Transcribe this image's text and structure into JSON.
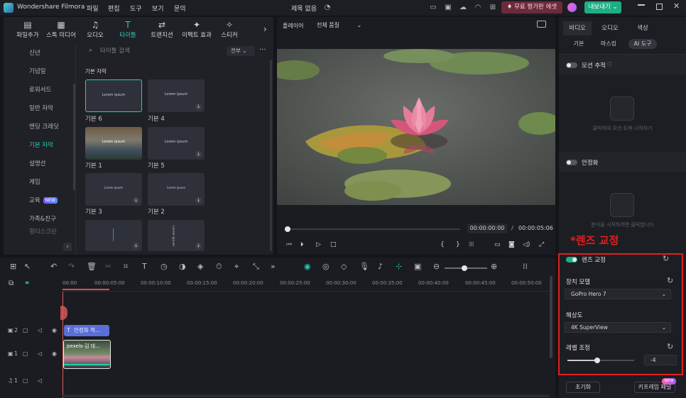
{
  "titlebar": {
    "app_name": "Wondershare Filmora",
    "menu": [
      "파일",
      "편집",
      "도구",
      "보기",
      "문의"
    ],
    "project_title": "제목 없음",
    "trial_button": "무료 평가판 에셋",
    "export_button": "내보내기"
  },
  "media_tabs": [
    {
      "label": "파일추가",
      "icon": "file-import-icon"
    },
    {
      "label": "스톡 미디어",
      "icon": "stock-media-icon"
    },
    {
      "label": "오디오",
      "icon": "music-icon"
    },
    {
      "label": "타이틀",
      "icon": "title-t-icon"
    },
    {
      "label": "트랜지션",
      "icon": "transition-icon"
    },
    {
      "label": "이펙트 효과",
      "icon": "effects-icon"
    },
    {
      "label": "스티커",
      "icon": "sticker-icon"
    }
  ],
  "categories": [
    "신년",
    "기념일",
    "로워서드",
    "일반 자막",
    "엔딩 크레딧",
    "기본 자막",
    "설명선",
    "게임",
    "교육",
    "가족&친구",
    "멀티스크린"
  ],
  "category_active": "기본 자막",
  "category_new_badge": "NEW",
  "search": {
    "placeholder": "타이틀 검색",
    "filter": "전부"
  },
  "section_title": "기본 자막",
  "tiles": [
    {
      "label": "기본 6",
      "preview": "Lorem ipsum"
    },
    {
      "label": "기본 4",
      "preview": "Lorem ipsum"
    },
    {
      "label": "기본 1",
      "preview": "Lorem ipsum"
    },
    {
      "label": "기본 5",
      "preview": "Lorem ipsum"
    },
    {
      "label": "기본 3",
      "preview": "Lorem ipsum"
    },
    {
      "label": "기본 2",
      "preview": "Lorem ipsum"
    },
    {
      "label": "",
      "preview": ""
    },
    {
      "label": "",
      "preview": "Lorem ipsum"
    }
  ],
  "player": {
    "label": "플레이어",
    "quality": "전체 품질",
    "current_time": "00:00:00:00",
    "separator": "/",
    "total_time": "00:00:05:06"
  },
  "right_panel": {
    "tabs": [
      "비디오",
      "오디오",
      "색상"
    ],
    "subtabs": [
      "기본",
      "마스킹",
      "AI 도구"
    ],
    "motion_tracking": "모션 추적",
    "motion_hint": "클릭하여 모션 트랙 시작하기",
    "stabilization": "안정화",
    "stabilization_hint": "분석을 시작하려면 클릭합니다",
    "annotation": "*렌즈 교정",
    "lens_correction": "렌즈 교정",
    "device_model_label": "장치 모델",
    "device_model_value": "GoPro Hero 7",
    "resolution_label": "해상도",
    "resolution_value": "4K SuperView",
    "level_label": "레벨 조정",
    "level_value": "-4",
    "level_fraction": 0.45,
    "reset_button": "초기화",
    "keyframe_button": "키프레임 패널",
    "keyframe_badge": "NEW"
  },
  "timeline": {
    "ticks": [
      "00:00",
      "00:00:05:00",
      "00:00:10:00",
      "00:00:15:00",
      "00:00:20:00",
      "00:00:25:00",
      "00:00:30:00",
      "00:00:35:00",
      "00:00:40:00",
      "00:00:45:00",
      "00:00:50:00"
    ],
    "title_clip": "안정화 적...",
    "video_clip": "pexels-김 대...",
    "tracks": [
      "2",
      "1",
      "1"
    ]
  },
  "colors": {
    "accent": "#21d0b2",
    "highlight_border": "#e02020",
    "annotation_text": "#e02020"
  }
}
